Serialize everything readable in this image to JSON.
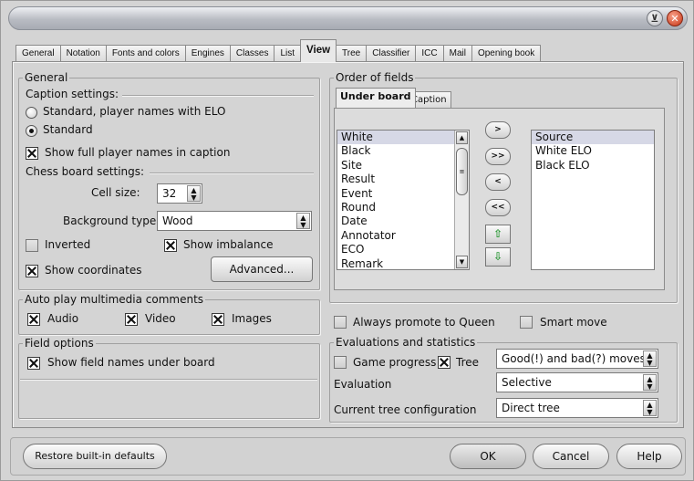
{
  "window": {
    "title": "",
    "min_glyph": "⊻",
    "close_glyph": "✕"
  },
  "tabs": [
    "General",
    "Notation",
    "Fonts and colors",
    "Engines",
    "Classes",
    "List",
    "View",
    "Tree",
    "Classifier",
    "ICC",
    "Mail",
    "Opening book"
  ],
  "active_tab": "View",
  "general": {
    "legend": "General",
    "caption_settings": "Caption settings:",
    "radio_elo": "Standard, player names with ELO",
    "radio_standard": "Standard",
    "show_full_names": "Show full player names in caption",
    "chess_board_settings": "Chess board settings:",
    "cell_size_label": "Cell size:",
    "cell_size_value": "32",
    "background_type_label": "Background type:",
    "background_type_value": "Wood",
    "inverted": "Inverted",
    "show_imbalance": "Show imbalance",
    "show_coordinates": "Show coordinates",
    "advanced": "Advanced..."
  },
  "auto_play": {
    "legend": "Auto play multimedia comments",
    "audio": "Audio",
    "video": "Video",
    "images": "Images"
  },
  "field_options": {
    "legend": "Field options",
    "show_field_names": "Show field names under board"
  },
  "order_of_fields": {
    "legend": "Order of fields",
    "tab_under_board": "Under board",
    "tab_caption": "Caption",
    "available": [
      "White",
      "Black",
      "Site",
      "Result",
      "Event",
      "Round",
      "Date",
      "Annotator",
      "ECO",
      "Remark"
    ],
    "selected": [
      "Source",
      "White ELO",
      "Black ELO"
    ],
    "btn_add": ">",
    "btn_add_all": ">>",
    "btn_remove": "<",
    "btn_remove_all": "<<",
    "btn_up": "⇧",
    "btn_down": "⇩"
  },
  "promote": {
    "always_promote": "Always promote to Queen",
    "smart_move": "Smart move"
  },
  "evaluations": {
    "legend": "Evaluations and statistics",
    "game_progress": "Game progress",
    "tree": "Tree",
    "moves_select": "Good(!) and bad(?) moves",
    "evaluation_label": "Evaluation",
    "evaluation_value": "Selective",
    "tree_config_label": "Current tree configuration",
    "tree_config_value": "Direct tree"
  },
  "footer": {
    "restore": "Restore built-in defaults",
    "ok": "OK",
    "cancel": "Cancel",
    "help": "Help"
  },
  "colors": {
    "selection": "#d6d8e6",
    "close_button": "#c53212",
    "arrow_green": "#2f9a3a"
  }
}
